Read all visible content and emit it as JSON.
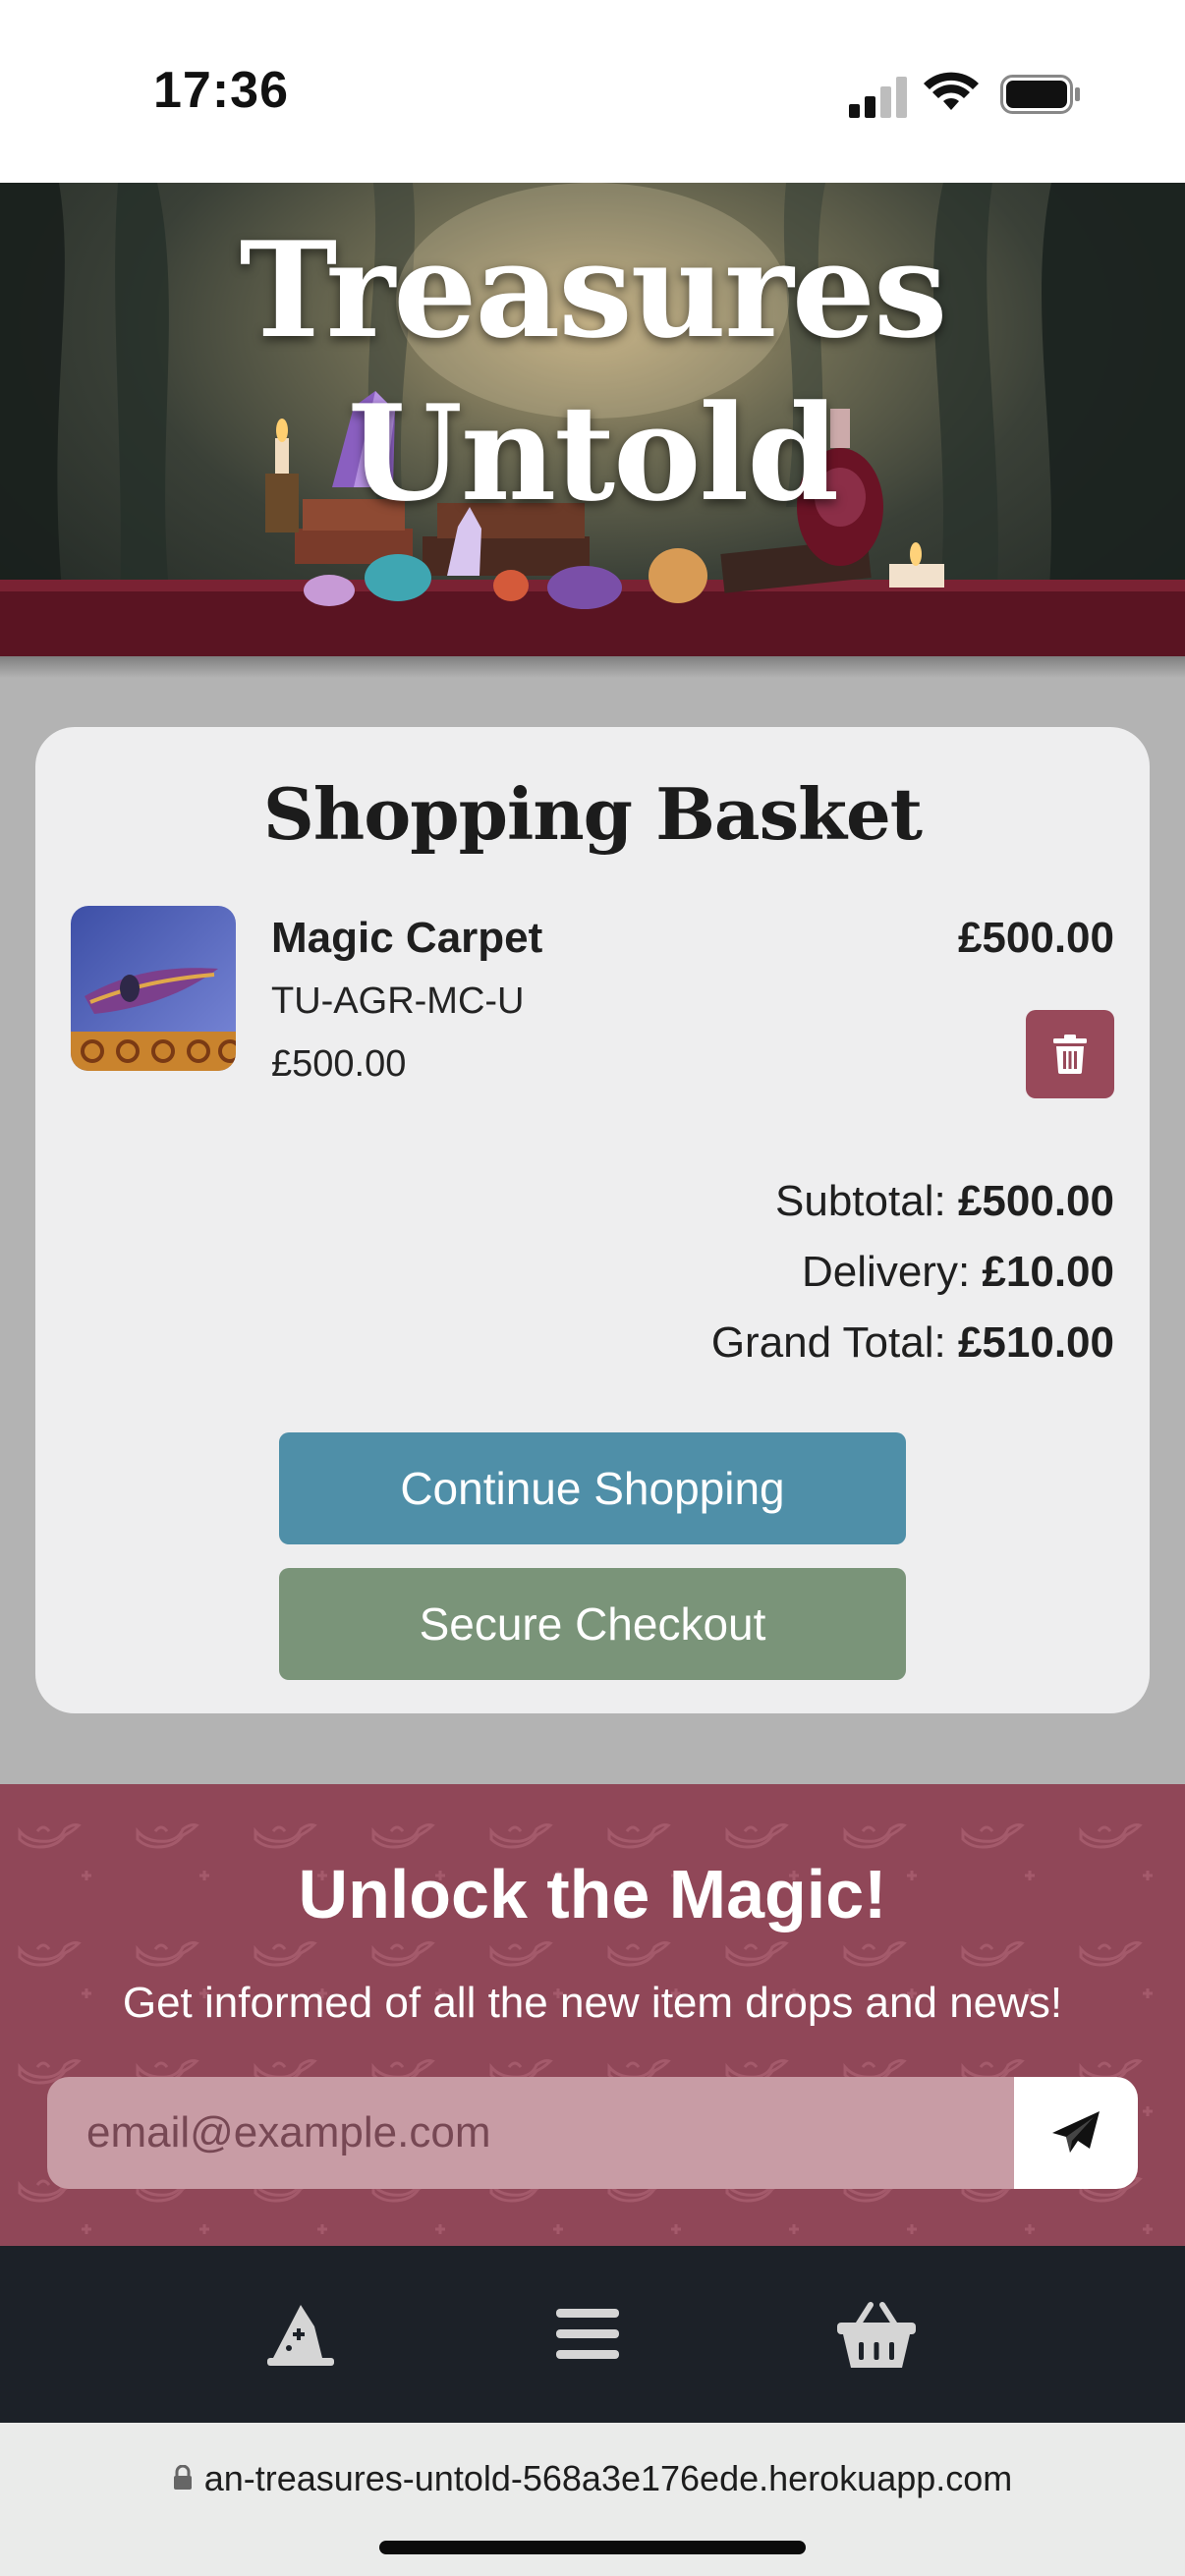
{
  "status_bar": {
    "time": "17:36"
  },
  "hero": {
    "title_line1": "Treasures",
    "title_line2": "Untold"
  },
  "basket": {
    "title": "Shopping Basket",
    "items": [
      {
        "name": "Magic Carpet",
        "sku": "TU-AGR-MC-U",
        "price": "£500.00",
        "line_total": "£500.00",
        "image_icon": "magic-carpet-thumbnail"
      }
    ],
    "subtotal_label": "Subtotal:",
    "subtotal_value": "£500.00",
    "delivery_label": "Delivery:",
    "delivery_value": "£10.00",
    "grand_total_label": "Grand Total:",
    "grand_total_value": "£510.00",
    "continue_label": "Continue Shopping",
    "checkout_label": "Secure Checkout"
  },
  "newsletter": {
    "heading": "Unlock the Magic!",
    "subtext": "Get informed of all the new item drops and news!",
    "email_placeholder": "email@example.com",
    "submit_icon": "paper-plane-icon"
  },
  "bottom_nav": {
    "items": [
      {
        "icon": "wizard-hat-icon"
      },
      {
        "icon": "hamburger-menu-icon"
      },
      {
        "icon": "basket-icon"
      }
    ]
  },
  "url_bar": {
    "url": "an-treasures-untold-568a3e176ede.herokuapp.com"
  },
  "colors": {
    "page_background": "#b3b3b3",
    "card_background": "#eeeeef",
    "delete_button": "#98495a",
    "continue_button": "#4f8fa8",
    "checkout_button": "#7a9479",
    "newsletter_background": "#904758",
    "nav_background": "#1c2128"
  }
}
